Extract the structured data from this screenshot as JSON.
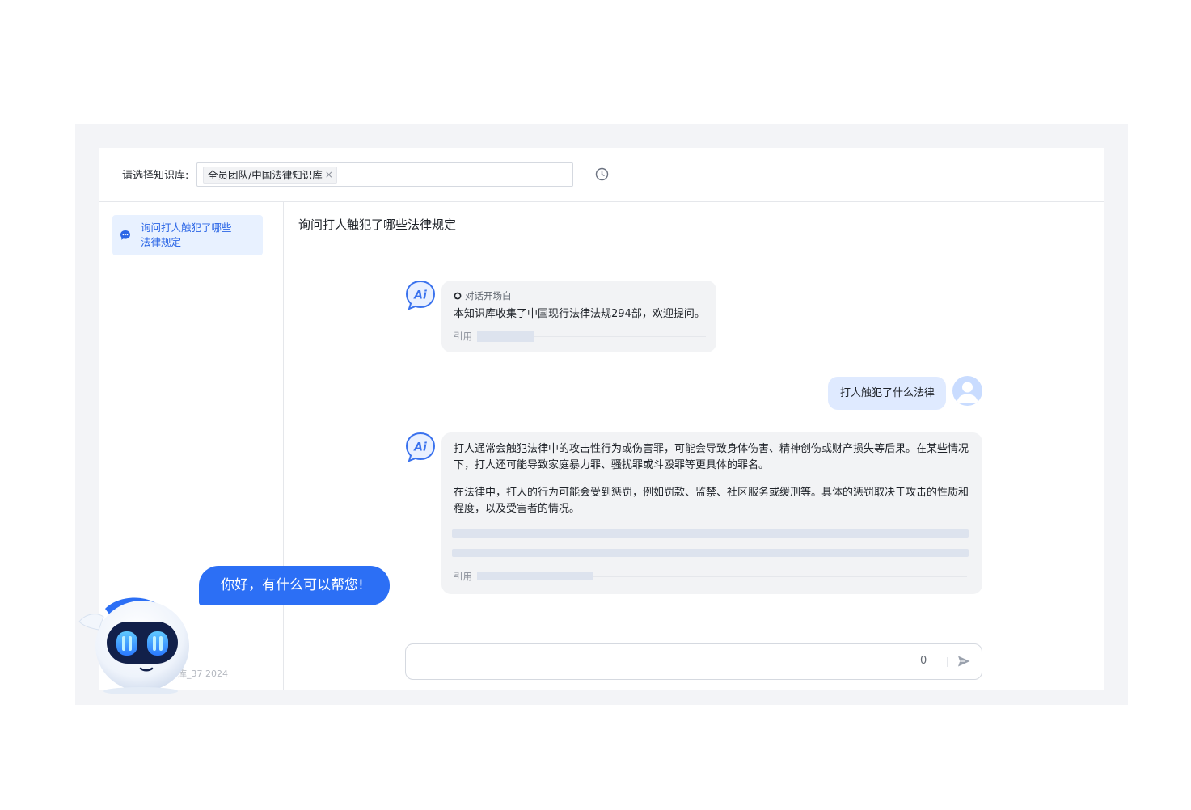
{
  "header": {
    "kb_label": "请选择知识库:",
    "kb_tag": "全员团队/中国法律知识库",
    "kb_tag_remove": "×",
    "history_icon": "clock-icon"
  },
  "sidebar": {
    "items": [
      {
        "label": "询问打人触犯了哪些法律规定",
        "icon": "chat-bubble-icon",
        "active": true
      }
    ],
    "footer": "库_37 2024"
  },
  "chat": {
    "title": "询问打人触犯了哪些法律规定",
    "messages": [
      {
        "role": "assistant",
        "scene_label": "对话开场白",
        "text": "本知识库收集了中国现行法律法规294部，欢迎提问。",
        "cite_label": "引用"
      },
      {
        "role": "user",
        "text": "打人触犯了什么法律"
      },
      {
        "role": "assistant",
        "paragraphs": [
          "打人通常会触犯法律中的攻击性行为或伤害罪，可能会导致身体伤害、精神创伤或财产损失等后果。在某些情况下，打人还可能导致家庭暴力罪、骚扰罪或斗殴罪等更具体的罪名。",
          "在法律中，打人的行为可能会受到惩罚，例如罚款、监禁、社区服务或缓刑等。具体的惩罚取决于攻击的性质和程度，以及受害者的情况。"
        ],
        "cite_label": "引用"
      }
    ],
    "input": {
      "value": "",
      "char_count": "0",
      "send_icon": "send-icon"
    }
  },
  "assistant_bot": {
    "greeting": "你好，有什么可以帮您!"
  },
  "colors": {
    "accent": "#2b66e6",
    "user_bubble": "#dfeaff",
    "ai_bubble": "#f2f3f5",
    "bot_speech": "#2c6ff5"
  }
}
